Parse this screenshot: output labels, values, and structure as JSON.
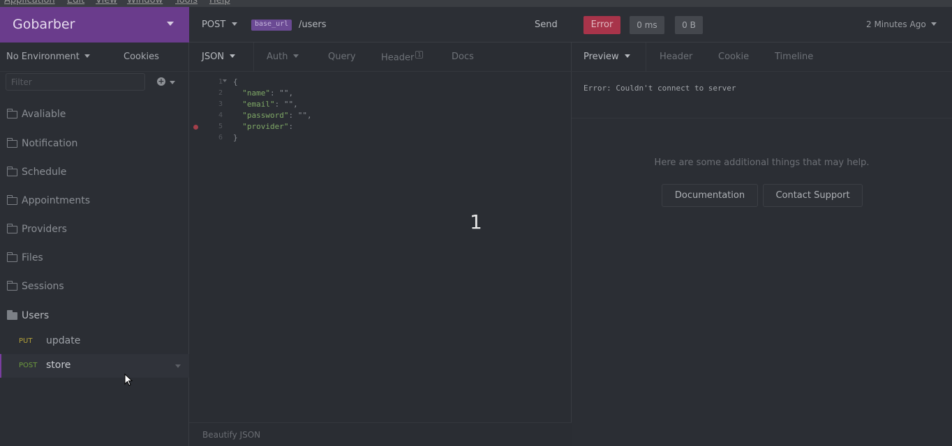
{
  "menu": [
    "Application",
    "Edit",
    "View",
    "Window",
    "Tools",
    "Help"
  ],
  "workspace": {
    "name": "Gobarber"
  },
  "environment": {
    "label": "No Environment",
    "cookies_label": "Cookies"
  },
  "filter": {
    "placeholder": "Filter"
  },
  "folders": [
    {
      "label": "Avaliable"
    },
    {
      "label": "Notification"
    },
    {
      "label": "Schedule"
    },
    {
      "label": "Appointments"
    },
    {
      "label": "Providers"
    },
    {
      "label": "Files"
    },
    {
      "label": "Sessions"
    },
    {
      "label": "Users"
    }
  ],
  "requests": [
    {
      "method": "PUT",
      "name": "update",
      "color": "#b6a33a"
    },
    {
      "method": "POST",
      "name": "store",
      "color": "#6d9b3e"
    }
  ],
  "request": {
    "method": "POST",
    "base_tag": "base_url",
    "path": "/users",
    "send_label": "Send"
  },
  "tabs": {
    "body": "JSON",
    "auth": "Auth",
    "query": "Query",
    "header": "Header",
    "header_count": "1",
    "docs": "Docs"
  },
  "code_lines": [
    {
      "n": "1",
      "text": "{"
    },
    {
      "n": "2",
      "key": "\"name\"",
      "rest": ": \"\","
    },
    {
      "n": "3",
      "key": "\"email\"",
      "rest": ": \"\","
    },
    {
      "n": "4",
      "key": "\"password\"",
      "rest": ": \"\","
    },
    {
      "n": "5",
      "key": "\"provider\"",
      "rest": ":"
    },
    {
      "n": "6",
      "text": "}"
    }
  ],
  "overlay_number": "1",
  "beautify_label": "Beautify JSON",
  "response": {
    "status": "Error",
    "time": "0 ms",
    "size": "0 B",
    "ago": "2 Minutes Ago",
    "status_color": "#a8344a"
  },
  "response_tabs": {
    "preview": "Preview",
    "header": "Header",
    "cookie": "Cookie",
    "timeline": "Timeline"
  },
  "error_message": "Error: Couldn't connect to server",
  "help_text": "Here are some additional things that may help.",
  "buttons": {
    "documentation": "Documentation",
    "contact": "Contact Support"
  },
  "accent_color": "#6a3c8c"
}
